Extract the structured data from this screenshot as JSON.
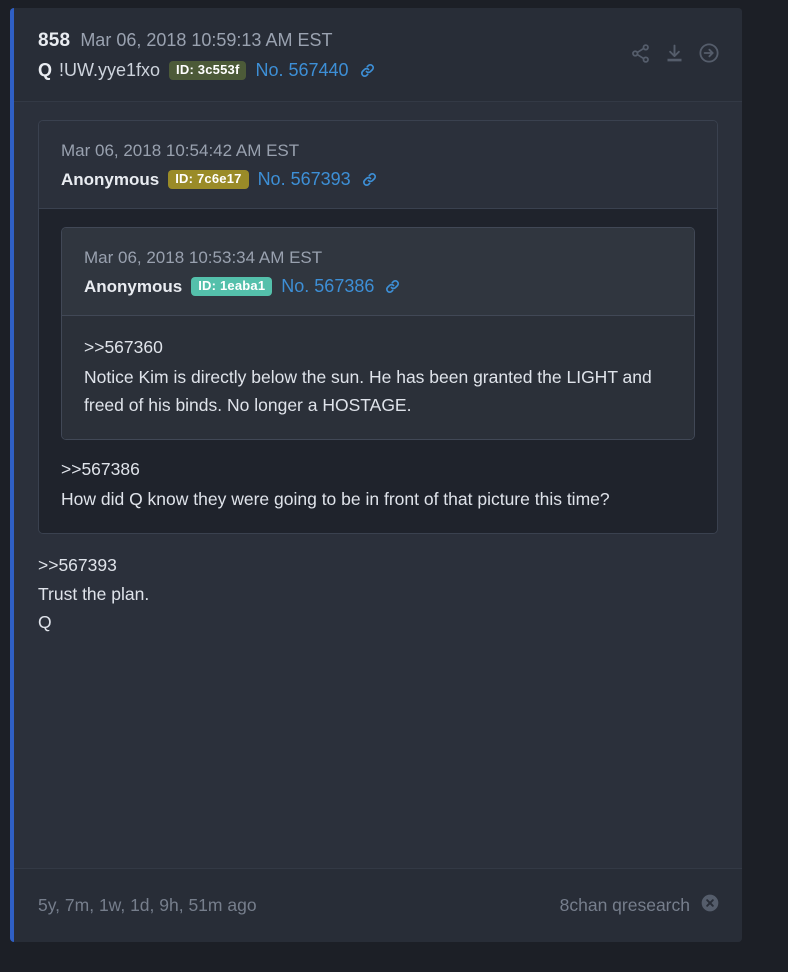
{
  "theme": {
    "page_bg": "#1c1f26",
    "card_bg": "#2b303b",
    "header_bg": "#282d37",
    "accent_blue": "#2f5fc4",
    "link_blue": "#3d8fd6",
    "muted_text": "#9aa2b0",
    "body_text": "#dfe3ea"
  },
  "post": {
    "index": "858",
    "date": "Mar 06, 2018 10:59:13 AM EST",
    "author_name": "Q",
    "tripcode": "!UW.yye1fxo",
    "id_label": "ID: 3c553f",
    "id_color": "#4c5a38",
    "post_number": "No. 567440",
    "link_icon": "link-icon",
    "actions": [
      {
        "name": "share-icon",
        "label": "Share"
      },
      {
        "name": "download-icon",
        "label": "Download"
      },
      {
        "name": "arrow-right-circle-icon",
        "label": "Open"
      }
    ],
    "body": {
      "reference": ">>567393",
      "lines": [
        "Trust the plan.",
        "Q"
      ]
    }
  },
  "quote_level1": {
    "date": "Mar 06, 2018 10:54:42 AM EST",
    "author_name": "Anonymous",
    "id_label": "ID: 7c6e17",
    "id_color": "#9a8b28",
    "post_number": "No. 567393",
    "link_icon": "link-icon",
    "body": {
      "reference": ">>567386",
      "text": "How did Q know they were going to be in front of that picture this time?"
    }
  },
  "quote_level2": {
    "date": "Mar 06, 2018 10:53:34 AM EST",
    "author_name": "Anonymous",
    "id_label": "ID: 1eaba1",
    "id_color": "#54c0ab",
    "post_number": "No. 567386",
    "link_icon": "link-icon",
    "body": {
      "reference": ">>567360",
      "text": "Notice Kim is directly below the sun. He has been granted the LIGHT and freed of his binds. No longer a HOSTAGE."
    }
  },
  "footer": {
    "relative_time": "5y, 7m, 1w, 1d, 9h, 51m ago",
    "source": "8chan qresearch",
    "close_icon": "close-circle-icon"
  }
}
